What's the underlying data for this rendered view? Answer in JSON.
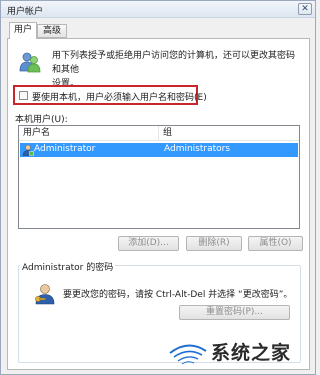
{
  "window": {
    "title": "用户帐户",
    "close_glyph": "✕"
  },
  "tabs": [
    {
      "label": "用户",
      "selected": true
    },
    {
      "label": "高级",
      "selected": false
    }
  ],
  "intro": {
    "line1": "用下列表授予或拒绝用户访问您的计算机，还可以更改其密码和其他",
    "line2": "设置。"
  },
  "require_login": {
    "label": "要使用本机，用户必须输入用户名和密码(E)",
    "checked": false
  },
  "users_list": {
    "label": "本机用户(U):",
    "columns": [
      "用户名",
      "组"
    ],
    "rows": [
      {
        "name": "Administrator",
        "group": "Administrators",
        "selected": true
      }
    ]
  },
  "buttons": {
    "add": "添加(D)...",
    "delete": "删除(R)",
    "properties": "属性(O)"
  },
  "password_group": {
    "title": "Administrator 的密码",
    "text": "要更改您的密码，请按 Ctrl-Alt-Del 并选择 “更改密码”。",
    "reset_button": "重置密码(P)..."
  },
  "watermark": {
    "text": "系统之家"
  },
  "colors": {
    "selection": "#3399ff",
    "highlight_border": "#c8262a",
    "watermark_blue": "#1f6fd1"
  },
  "icons": [
    "users-icon",
    "user-row-icon",
    "key-user-icon",
    "close-icon",
    "checkbox"
  ]
}
